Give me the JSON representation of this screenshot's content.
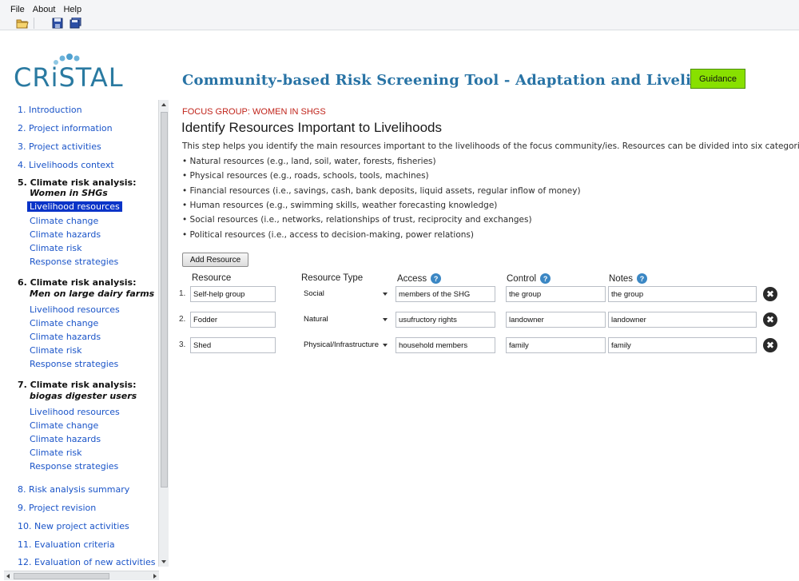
{
  "menu": {
    "file": "File",
    "about": "About",
    "help": "Help"
  },
  "header": {
    "logo": "CRiSTAL",
    "title": "Community-based Risk Screening Tool - Adaptation and Livelihoods",
    "guidance_label": "Guidance"
  },
  "sidebar": {
    "s1": "1. Introduction",
    "s2": "2. Project information",
    "s3": "3. Project activities",
    "s4": "4. Livelihoods context",
    "s5_title": "5. Climate risk analysis:",
    "s5_group": "Women in SHGs",
    "s5_items": [
      "Livelihood resources",
      "Climate change",
      "Climate hazards",
      "Climate risk",
      "Response strategies"
    ],
    "s6_title": "6. Climate risk analysis:",
    "s6_group": "Men on large dairy farms",
    "s6_items": [
      "Livelihood resources",
      "Climate change",
      "Climate hazards",
      "Climate risk",
      "Response strategies"
    ],
    "s7_title": "7. Climate risk analysis:",
    "s7_group": "biogas digester users",
    "s7_items": [
      "Livelihood resources",
      "Climate change",
      "Climate hazards",
      "Climate risk",
      "Response strategies"
    ],
    "s8": "8. Risk analysis summary",
    "s9": "9. Project revision",
    "s10": "10. New project activities",
    "s11": "11. Evaluation criteria",
    "s12": "12. Evaluation of new activities"
  },
  "main": {
    "focus_group": "FOCUS GROUP: WOMEN IN SHGS",
    "step_title": "Identify Resources Important to Livelihoods",
    "intro": "This step helps you identify the main resources important to the livelihoods of the focus community/ies. Resources can be divided into six categories:",
    "bullets": [
      "• Natural resources (e.g., land, soil, water, forests, fisheries)",
      "• Physical resources (e.g., roads, schools, tools, machines)",
      "• Financial resources (i.e., savings, cash, bank deposits, liquid assets, regular inflow of money)",
      "• Human resources (e.g., swimming skills, weather forecasting knowledge)",
      "• Social resources (i.e., networks, relationships of trust, reciprocity and exchanges)",
      "• Political resources (i.e., access to decision-making, power relations)"
    ],
    "add_resource_label": "Add Resource",
    "columns": {
      "resource": "Resource",
      "type": "Resource Type",
      "access": "Access",
      "control": "Control",
      "notes": "Notes"
    },
    "help_glyph": "?",
    "remove_glyph": "✖",
    "rows": [
      {
        "num": "1.",
        "resource": "Self-help group",
        "type": "Social",
        "access": "members of the SHG",
        "control": "the group",
        "notes": "the group"
      },
      {
        "num": "2.",
        "resource": "Fodder",
        "type": "Natural",
        "access": "usufructory rights",
        "control": "landowner",
        "notes": "landowner"
      },
      {
        "num": "3.",
        "resource": "Shed",
        "type": "Physical/Infrastructure",
        "access": "household members",
        "control": "family",
        "notes": "family"
      }
    ]
  }
}
